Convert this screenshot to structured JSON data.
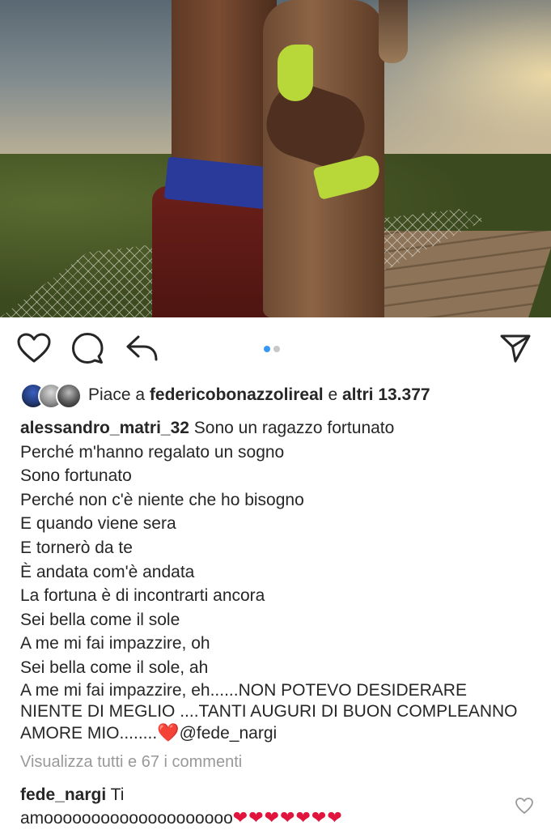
{
  "post": {
    "photo_alt": "",
    "carousel": {
      "total": 2,
      "active": 1
    },
    "likes": {
      "prefix": "Piace a ",
      "liker": "federicobonazzolireal",
      "middle": " e ",
      "others": "altri 13.377"
    },
    "caption": {
      "username": "alessandro_matri_32",
      "first_line": " Sono un ragazzo fortunato",
      "lines": [
        "Perché m'hanno regalato un sogno",
        "Sono fortunato",
        "Perché non c'è niente che ho bisogno",
        "E quando viene sera",
        "E tornerò da te",
        "È andata com'è andata",
        "La fortuna è di incontrarti ancora",
        "Sei bella come il sole",
        "A me mi fai impazzire, oh",
        "Sei bella come il sole, ah"
      ],
      "last_block": "A me mi fai impazzire, eh......NON POTEVO DESIDERARE NIENTE DI MEGLIO ....TANTI AUGURI DI BUON COMPLEANNO AMORE MIO........",
      "last_emoji": "❤️",
      "mention": "@fede_nargi"
    },
    "view_all_comments": "Visualizza tutti e 67 i commenti",
    "top_comment": {
      "username": "fede_nargi",
      "text_first": " Ti",
      "text_second": "amoooooooooooooooooooo",
      "hearts": "❤❤❤❤❤❤❤"
    }
  },
  "icons": {
    "like": "heart-outline-icon",
    "comment": "comment-bubble-icon",
    "share": "reply-arrow-icon",
    "send": "paper-plane-icon",
    "comment_like": "small-heart-outline-icon"
  },
  "colors": {
    "text": "#262626",
    "muted": "#999999",
    "carousel_active": "#3897f0",
    "carousel_inactive": "#c8c8c8",
    "heart_emoji": "#e0143c"
  }
}
